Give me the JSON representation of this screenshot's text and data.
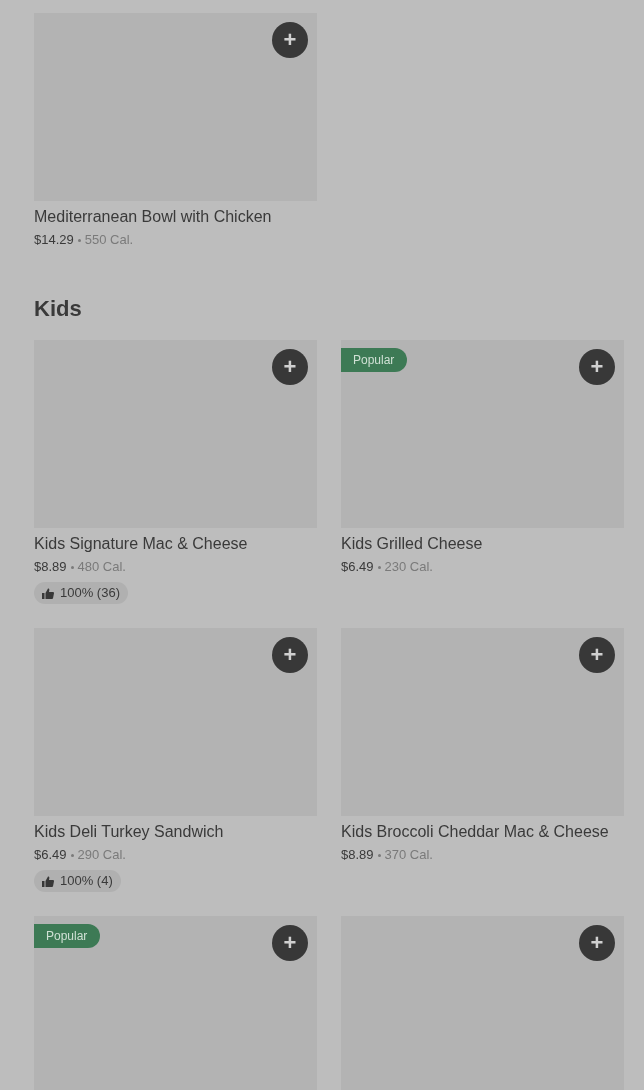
{
  "sections": [
    {
      "items": [
        {
          "add": "+",
          "name": "Mediterranean Bowl with Chicken",
          "price": "$14.29",
          "calories": "550 Cal."
        }
      ]
    },
    {
      "title": "Kids",
      "items": [
        {
          "add": "+",
          "name": "Kids Signature Mac & Cheese",
          "price": "$8.89",
          "calories": "480 Cal.",
          "rating": "100% (36)"
        },
        {
          "add": "+",
          "name": "Kids Grilled Cheese",
          "price": "$6.49",
          "calories": "230 Cal.",
          "badge": "Popular"
        },
        {
          "add": "+",
          "name": "Kids Deli Turkey Sandwich",
          "price": "$6.49",
          "calories": "290 Cal.",
          "rating": "100% (4)"
        },
        {
          "add": "+",
          "name": "Kids Broccoli Cheddar Mac & Cheese",
          "price": "$8.89",
          "calories": "370 Cal."
        },
        {
          "add": "+",
          "badge": "Popular"
        },
        {
          "add": "+"
        }
      ]
    }
  ]
}
